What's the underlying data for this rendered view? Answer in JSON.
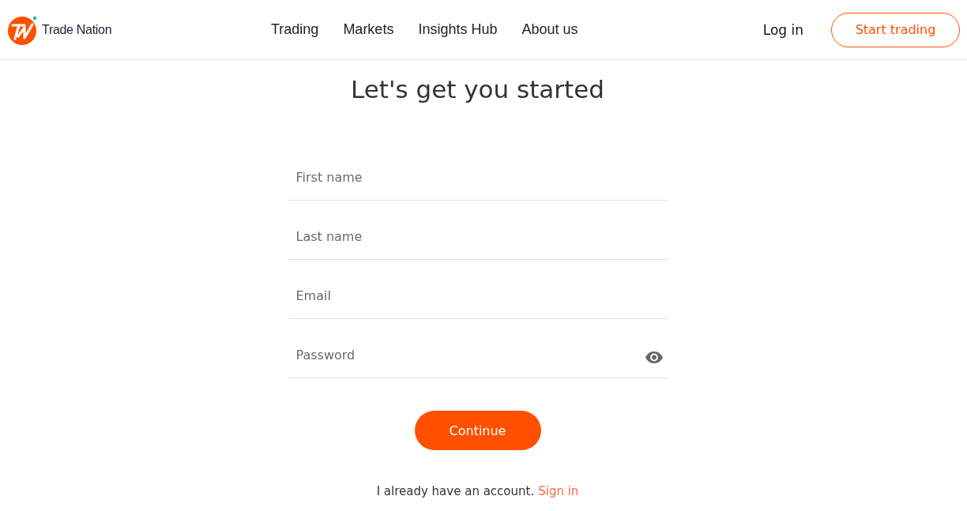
{
  "header": {
    "brand": "Trade Nation",
    "nav": [
      {
        "label": "Trading"
      },
      {
        "label": "Markets"
      },
      {
        "label": "Insights Hub"
      },
      {
        "label": "About us"
      }
    ],
    "login": "Log in",
    "cta": "Start trading"
  },
  "title": "Let's get you started",
  "form": {
    "fields": [
      {
        "kind": "text",
        "placeholder": "First name"
      },
      {
        "kind": "text",
        "placeholder": "Last name"
      },
      {
        "kind": "text",
        "placeholder": "Email"
      },
      {
        "kind": "password",
        "placeholder": "Password"
      }
    ],
    "submit": "Continue"
  },
  "footer": {
    "text": "I already have an account.",
    "link": "Sign in"
  }
}
